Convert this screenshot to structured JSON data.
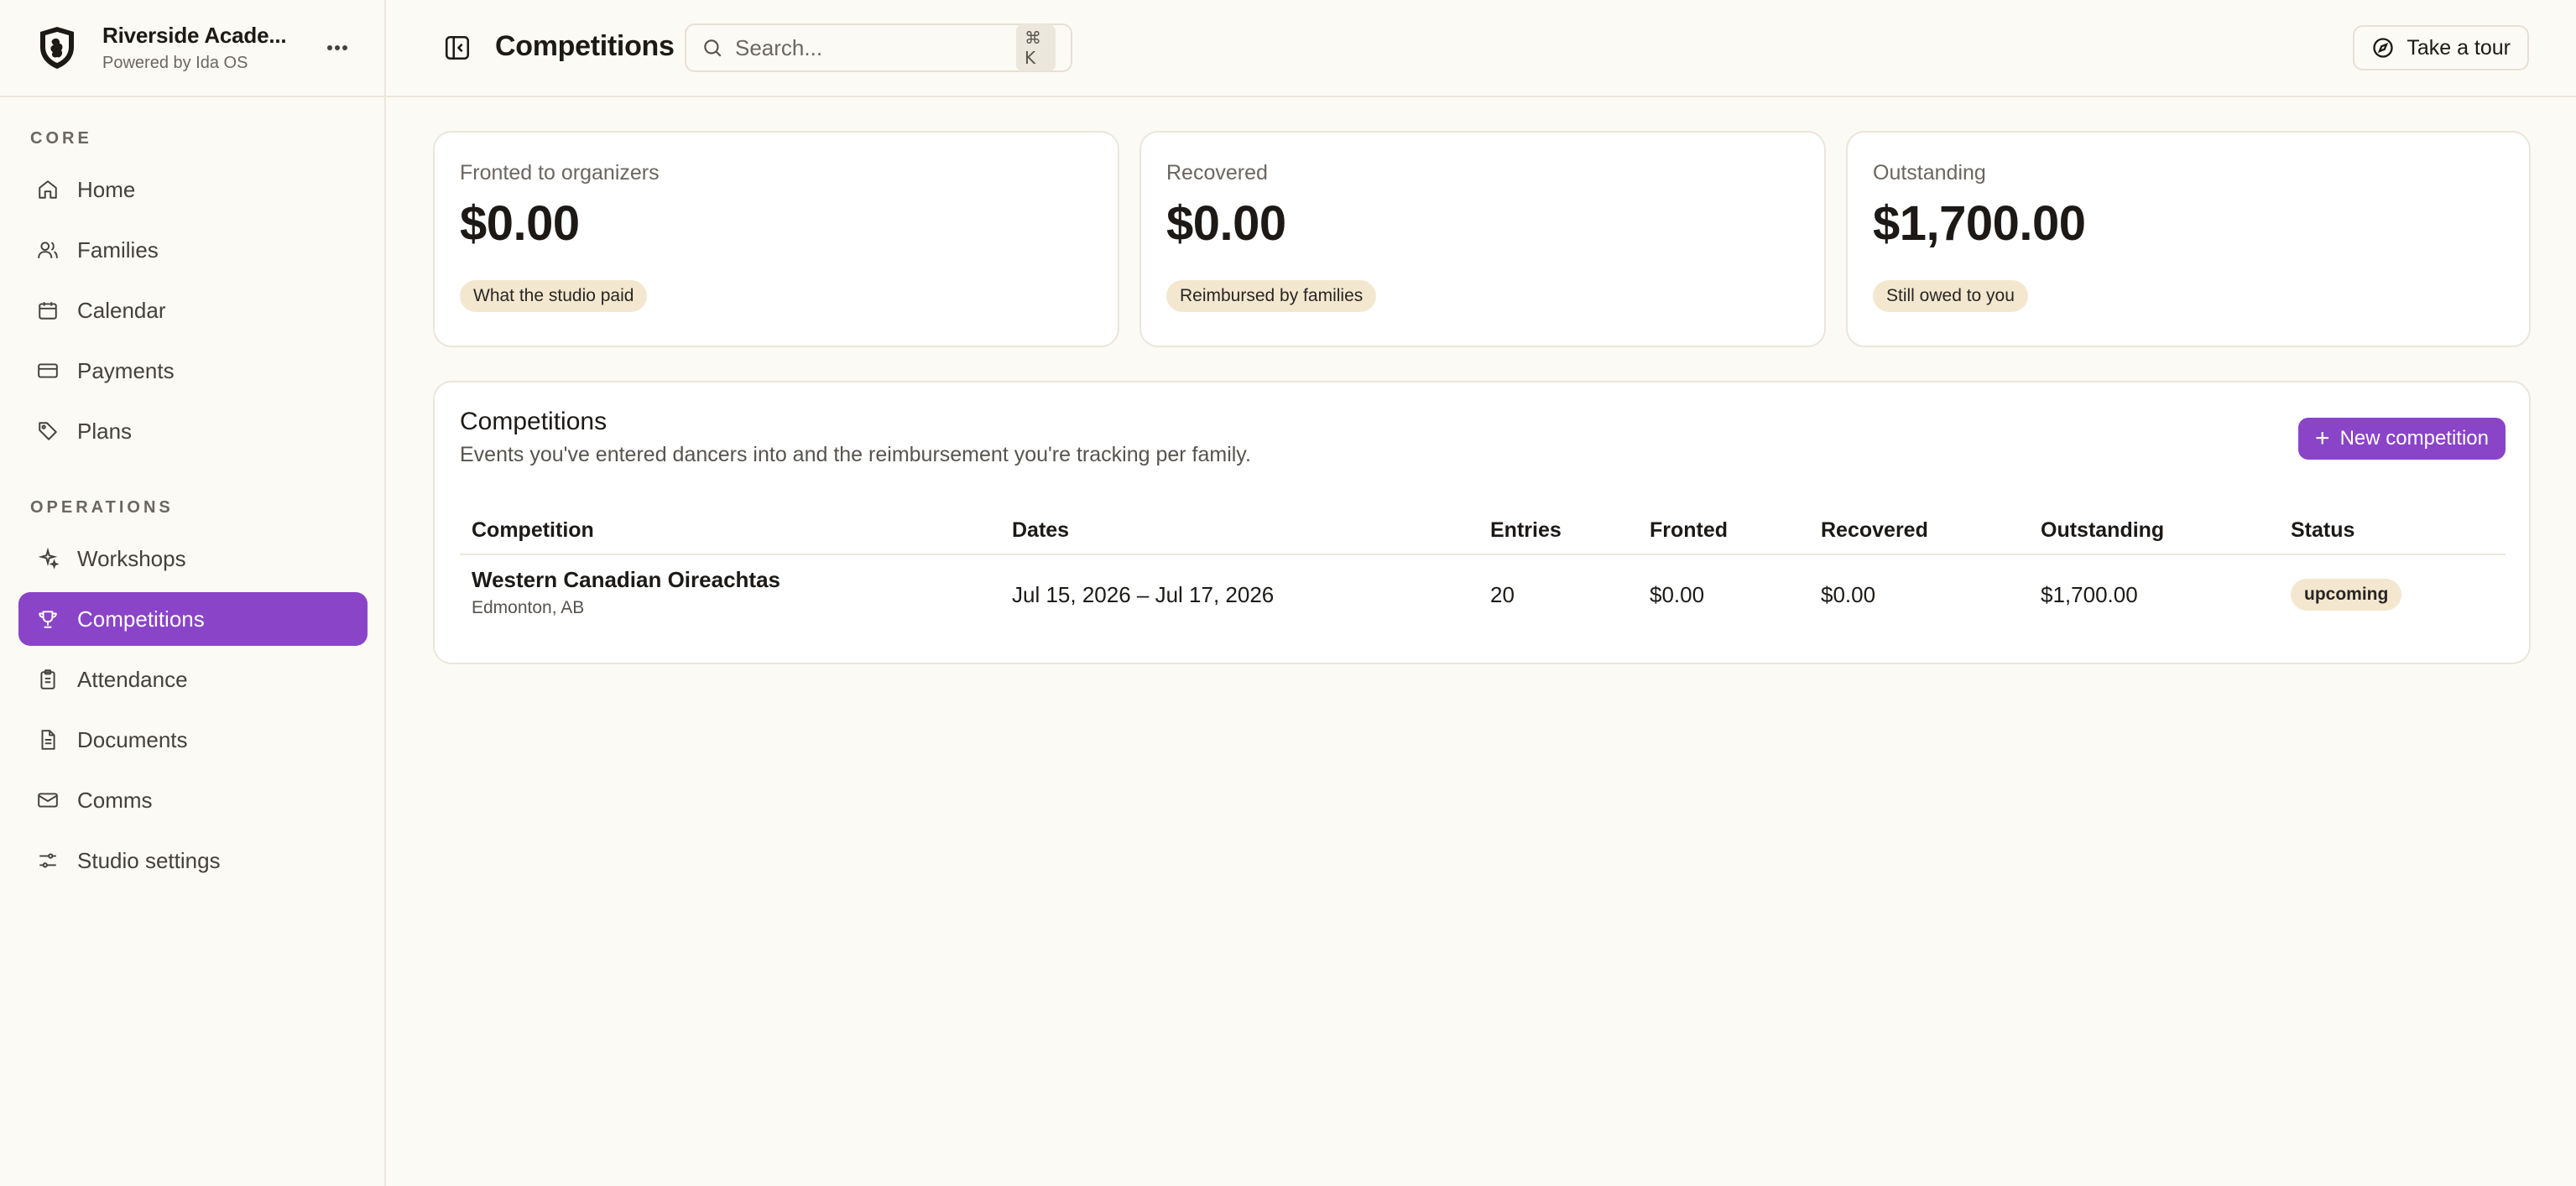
{
  "brand": {
    "name": "Riverside Acade...",
    "subtitle": "Powered by Ida OS",
    "logo_icon": "shield-crest-icon"
  },
  "sidebar": {
    "sections": [
      {
        "label": "CORE",
        "items": [
          {
            "label": "Home",
            "icon": "home-icon"
          },
          {
            "label": "Families",
            "icon": "users-icon"
          },
          {
            "label": "Calendar",
            "icon": "calendar-icon"
          },
          {
            "label": "Payments",
            "icon": "credit-card-icon"
          },
          {
            "label": "Plans",
            "icon": "tag-icon"
          }
        ]
      },
      {
        "label": "OPERATIONS",
        "items": [
          {
            "label": "Workshops",
            "icon": "sparkles-icon"
          },
          {
            "label": "Competitions",
            "icon": "trophy-icon",
            "active": true
          },
          {
            "label": "Attendance",
            "icon": "clipboard-icon"
          },
          {
            "label": "Documents",
            "icon": "file-icon"
          },
          {
            "label": "Comms",
            "icon": "mail-icon"
          },
          {
            "label": "Studio settings",
            "icon": "sliders-icon"
          }
        ]
      }
    ]
  },
  "header": {
    "title": "Competitions",
    "search": {
      "placeholder": "Search...",
      "shortcut": "⌘ K"
    },
    "tour_label": "Take a tour"
  },
  "stats": [
    {
      "label": "Fronted to organizers",
      "value": "$0.00",
      "note": "What the studio paid"
    },
    {
      "label": "Recovered",
      "value": "$0.00",
      "note": "Reimbursed by families"
    },
    {
      "label": "Outstanding",
      "value": "$1,700.00",
      "note": "Still owed to you"
    }
  ],
  "competitions": {
    "title": "Competitions",
    "subtitle": "Events you've entered dancers into and the reimbursement you're tracking per family.",
    "new_button": "New competition",
    "columns": [
      "Competition",
      "Dates",
      "Entries",
      "Fronted",
      "Recovered",
      "Outstanding",
      "Status"
    ],
    "rows": [
      {
        "name": "Western Canadian Oireachtas",
        "location": "Edmonton, AB",
        "dates": "Jul 15, 2026 – Jul 17, 2026",
        "entries": "20",
        "fronted": "$0.00",
        "recovered": "$0.00",
        "outstanding": "$1,700.00",
        "status": "upcoming"
      }
    ]
  },
  "colors": {
    "accent": "#8a44c8",
    "background": "#fcfaf4",
    "pill": "#f3e8cf",
    "border": "#ebe6dc"
  }
}
